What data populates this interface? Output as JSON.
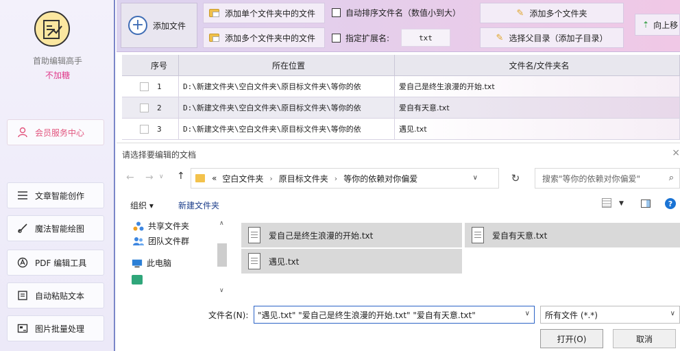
{
  "sidebar": {
    "app_name": "首助编辑高手",
    "status": "不加糖",
    "member": "会员服务中心",
    "items": [
      {
        "label": "文章智能创作"
      },
      {
        "label": "魔法智能绘图"
      },
      {
        "label": "PDF 编辑工具"
      },
      {
        "label": "自动粘贴文本"
      },
      {
        "label": "图片批量处理"
      }
    ]
  },
  "toolbar": {
    "add_file": "添加文件",
    "add_single_folder_files": "添加单个文件夹中的文件",
    "add_multi_folder_files": "添加多个文件夹中的文件",
    "auto_sort": "自动排序文件名（数值小到大）",
    "specify_ext": "指定扩展名:",
    "ext_value": "txt",
    "add_multi_folders": "添加多个文件夹",
    "choose_parent": "选择父目录（添加子目录）",
    "move_up": "向上移"
  },
  "table": {
    "headers": [
      "序号",
      "所在位置",
      "文件名/文件夹名"
    ],
    "rows": [
      {
        "index": "1",
        "path": "D:\\新建文件夹\\空白文件夹\\原目标文件夹\\等你的依",
        "name": "爱自己是终生浪漫的开始.txt"
      },
      {
        "index": "2",
        "path": "D:\\新建文件夹\\空白文件夹\\原目标文件夹\\等你的依",
        "name": "爱自有天意.txt"
      },
      {
        "index": "3",
        "path": "D:\\新建文件夹\\空白文件夹\\原目标文件夹\\等你的依",
        "name": "遇见.txt"
      }
    ]
  },
  "dialog": {
    "title": "请选择要编辑的文档",
    "close": "×",
    "breadcrumb": [
      "空白文件夹",
      "原目标文件夹",
      "等你的依赖对你偏爱"
    ],
    "breadcrumb_prefix": "«",
    "search_placeholder": "搜索\"等你的依赖对你偏爱\"",
    "organize": "组织 ▾",
    "new_folder": "新建文件夹",
    "help": "?",
    "tree": [
      {
        "label": "共享文件夹"
      },
      {
        "label": "团队文件群"
      },
      {
        "label": "此电脑"
      }
    ],
    "files": [
      {
        "name": "爱自己是终生浪漫的开始.txt"
      },
      {
        "name": "爱自有天意.txt"
      },
      {
        "name": "遇见.txt"
      }
    ],
    "filename_label": "文件名(N):",
    "filename_value": "\"遇见.txt\" \"爱自己是终生浪漫的开始.txt\" \"爱自有天意.txt\"",
    "filetype": "所有文件 (*.*)",
    "open": "打开(O)",
    "cancel": "取消"
  },
  "colors": {
    "accent_pink": "#e03a8a",
    "sidebar_border": "#7a86c8",
    "link_blue": "#1b3d8a"
  }
}
